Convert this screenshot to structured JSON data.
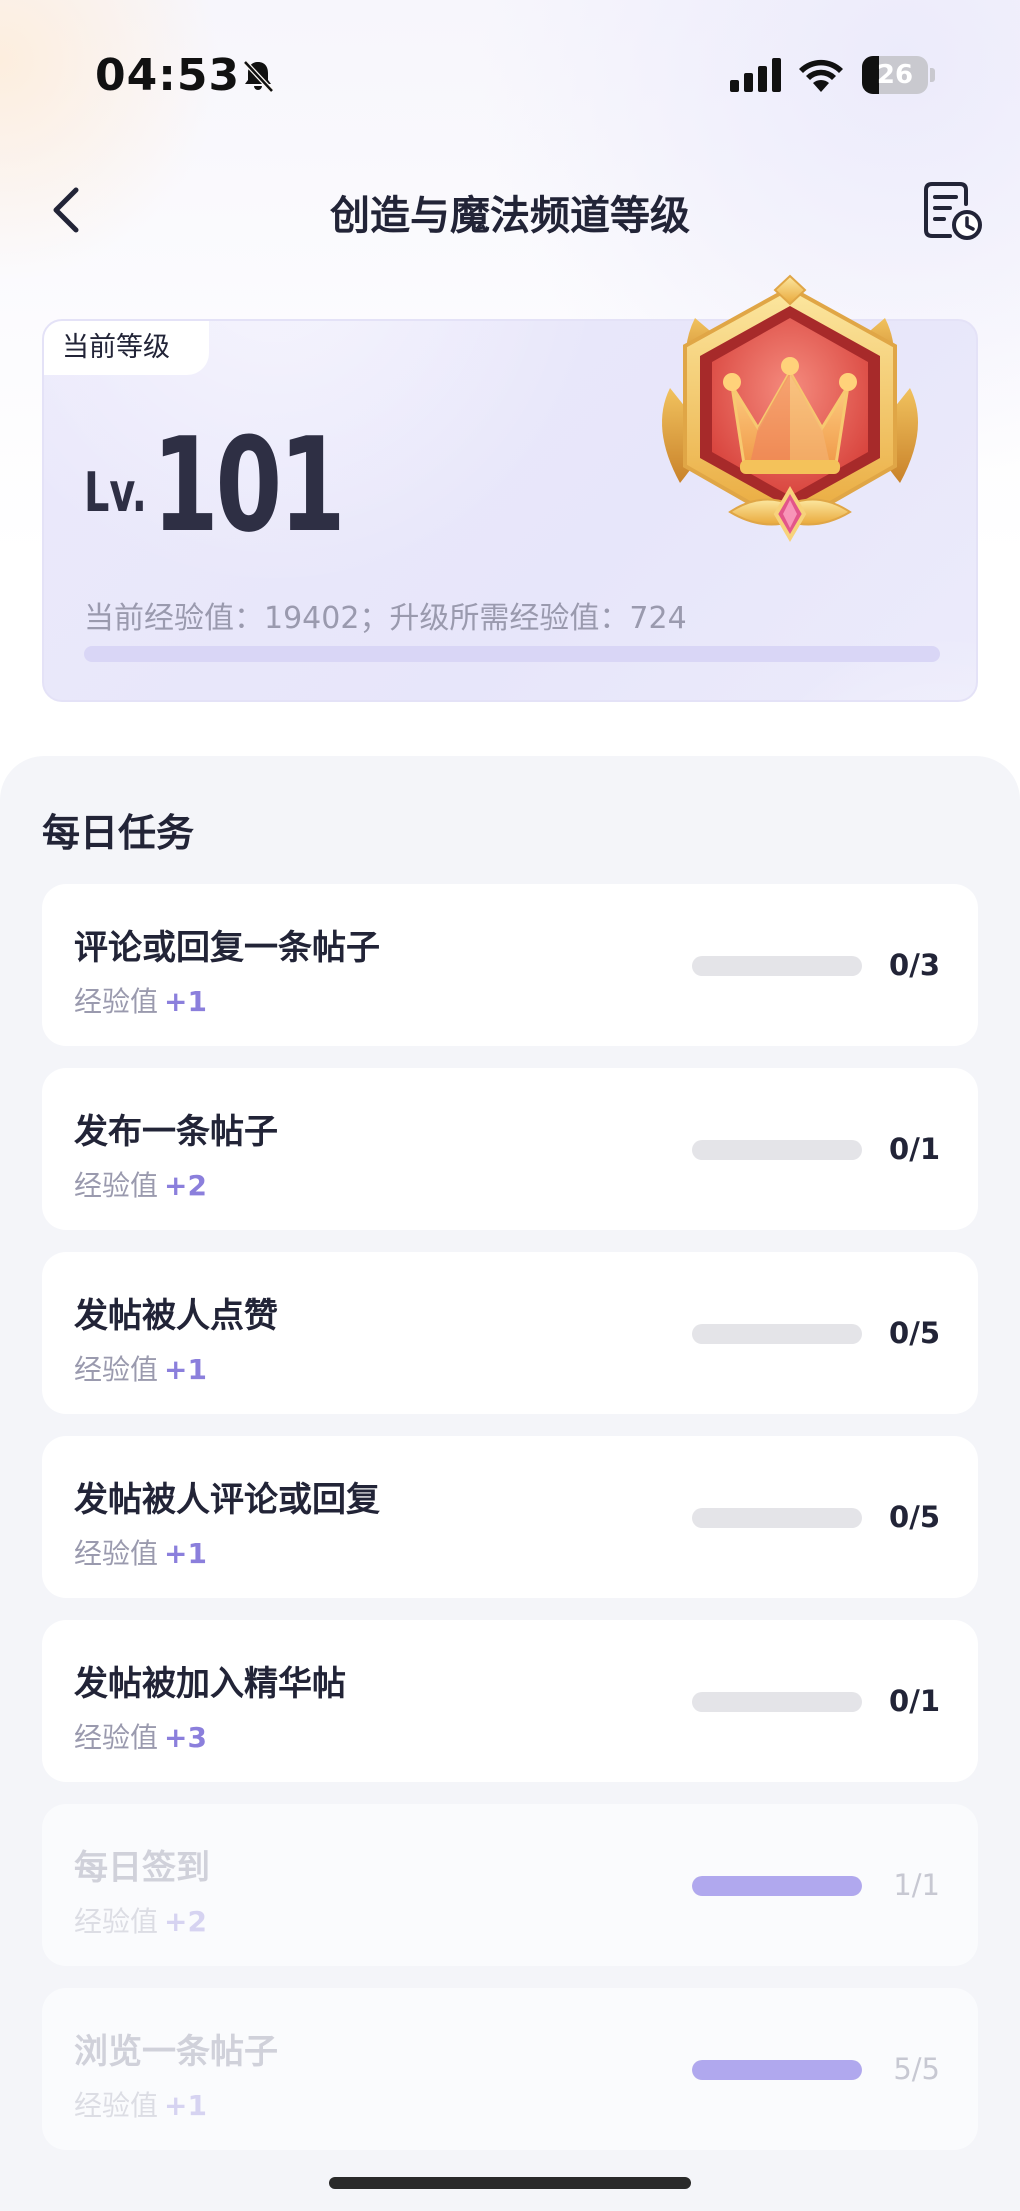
{
  "status_bar": {
    "time": "04:53",
    "battery": "26",
    "battery_level": 0.26,
    "icons": [
      "bell-slash-icon",
      "cellular-signal-icon",
      "wifi-icon",
      "battery-icon"
    ]
  },
  "nav": {
    "title": "创造与魔法频道等级",
    "back_icon": "chevron-left-icon",
    "history_icon": "history-list-icon"
  },
  "level_card": {
    "tag": "当前等级",
    "lv_prefix": "Lv.",
    "level": "101",
    "exp_text": "当前经验值：19402；升级所需经验值：724",
    "progress": 0.0,
    "badge_icon": "crown-badge-icon"
  },
  "tasks": {
    "title": "每日任务",
    "exp_label": "经验值",
    "items": [
      {
        "name": "评论或回复一条帖子",
        "exp": "+1",
        "progress": "0/3",
        "fill": 0,
        "done": false
      },
      {
        "name": "发布一条帖子",
        "exp": "+2",
        "progress": "0/1",
        "fill": 0,
        "done": false
      },
      {
        "name": "发帖被人点赞",
        "exp": "+1",
        "progress": "0/5",
        "fill": 0,
        "done": false
      },
      {
        "name": "发帖被人评论或回复",
        "exp": "+1",
        "progress": "0/5",
        "fill": 0,
        "done": false
      },
      {
        "name": "发帖被加入精华帖",
        "exp": "+3",
        "progress": "0/1",
        "fill": 0,
        "done": false
      },
      {
        "name": "每日签到",
        "exp": "+2",
        "progress": "1/1",
        "fill": 1,
        "done": true
      },
      {
        "name": "浏览一条帖子",
        "exp": "+1",
        "progress": "5/5",
        "fill": 1,
        "done": true
      }
    ]
  },
  "colors": {
    "accent": "#8b7fdc",
    "progress_fill": "#b0a8ee",
    "section_bg": "#f4f5f9",
    "text_primary": "#222437"
  }
}
